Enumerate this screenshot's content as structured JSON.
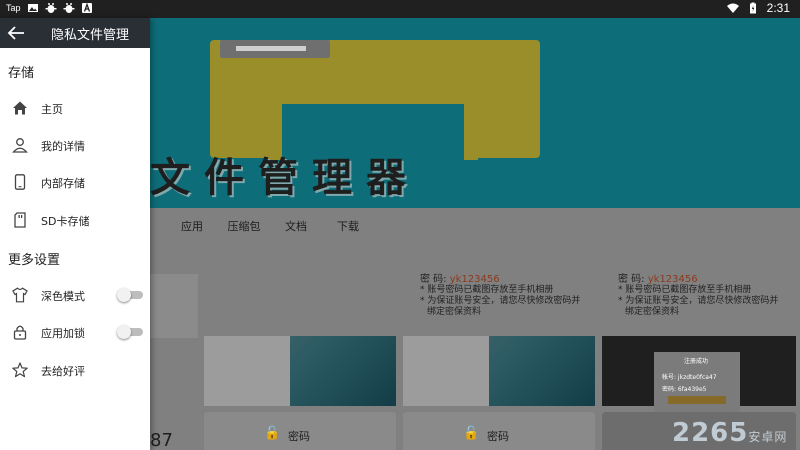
{
  "status_bar": {
    "tap_label": "Tap",
    "time": "2:31"
  },
  "drawer": {
    "title": "隐私文件管理",
    "storage_section": "存储",
    "storage_items": [
      {
        "label": "主页",
        "icon": "home-icon"
      },
      {
        "label": "我的详情",
        "icon": "person-icon"
      },
      {
        "label": "内部存储",
        "icon": "phone-icon"
      },
      {
        "label": "SD卡存储",
        "icon": "sd-card-icon"
      }
    ],
    "more_section": "更多设置",
    "settings_items": [
      {
        "label": "深色模式",
        "icon": "shirt-icon",
        "toggle": false
      },
      {
        "label": "应用加锁",
        "icon": "lock-icon",
        "toggle": false
      },
      {
        "label": "去给好评",
        "icon": "star-icon"
      }
    ]
  },
  "background": {
    "banner_text": "文件管理器",
    "tabs": [
      "应用",
      "压缩包",
      "文档",
      "下载"
    ],
    "cards": [
      {
        "password_label": "密 码: ",
        "password": "yk123456",
        "note1": "* 账号密码已截图存放至手机相册",
        "note2": "* 为保证账号安全，请您尽快修改密码并",
        "note3": "绑定密保资料"
      },
      {
        "password_label": "密 码: ",
        "password": "yk123456",
        "note1": "* 账号密码已截图存放至手机相册",
        "note2": "* 为保证账号安全，请您尽快修改密码并",
        "note3": "绑定密保资料"
      }
    ],
    "lock_label": "密码",
    "partial_number": "87",
    "popup": {
      "title": "注册成功",
      "row1": "帐号: jkzdte0fca47",
      "row2": "密码: 6fa439e5"
    },
    "watermark": "2265",
    "watermark_suffix": "安卓网"
  },
  "colors": {
    "drawer_header": "#2a2f36",
    "banner_bg": "#0d6e7a",
    "password_accent": "#8a3a1e"
  }
}
